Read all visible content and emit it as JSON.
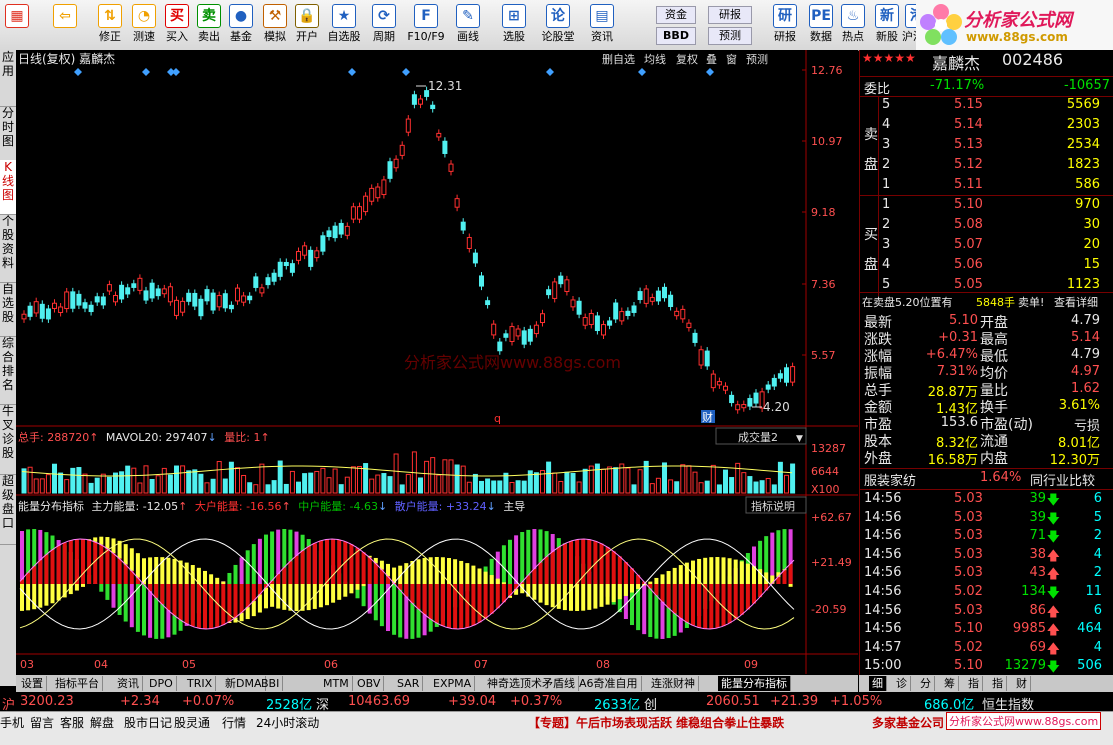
{
  "toolbar": {
    "buttons": [
      {
        "label": "",
        "icon": "windows-icon",
        "color": "#e03020"
      },
      {
        "label": "",
        "icon": "back-arrow-icon",
        "color": "#f0a000"
      },
      {
        "label": "修正",
        "icon": "up-down-icon",
        "color": "#f0a000"
      },
      {
        "label": "测速",
        "icon": "clock-icon",
        "color": "#f0a000"
      },
      {
        "label": "买入",
        "icon": "buy-icon",
        "color": "#e00000"
      },
      {
        "label": "卖出",
        "icon": "sell-icon",
        "color": "#009000"
      },
      {
        "label": "基金",
        "icon": "fund-icon",
        "color": "#2060c0"
      },
      {
        "label": "模拟",
        "icon": "hammer-icon",
        "color": "#c06000"
      },
      {
        "label": "开户",
        "icon": "lock-icon",
        "color": "#806000"
      },
      {
        "label": "自选股",
        "icon": "star-board-icon",
        "color": "#2060c0"
      },
      {
        "label": "周期",
        "icon": "cycle-icon",
        "color": "#2060c0"
      },
      {
        "label": "F10/F9",
        "icon": "f10-icon",
        "color": "#2060c0"
      },
      {
        "label": "画线",
        "icon": "pen-icon",
        "color": "#2060c0"
      },
      {
        "label": "选股",
        "icon": "select-icon",
        "color": "#2060c0"
      },
      {
        "label": "论股堂",
        "icon": "lun-icon",
        "color": "#2060c0"
      },
      {
        "label": "资讯",
        "icon": "news-icon",
        "color": "#2060c0"
      },
      {
        "label": "资金",
        "icon": "money-icon",
        "color": "#2060c0"
      },
      {
        "label": "研报",
        "icon": "report-icon",
        "color": "#2060c0"
      },
      {
        "label": "数据",
        "icon": "pe-icon",
        "color": "#2060c0"
      },
      {
        "label": "热点",
        "icon": "hot-icon",
        "color": "#2060c0"
      },
      {
        "label": "新股",
        "icon": "new-stock-icon",
        "color": "#2060c0"
      },
      {
        "label": "沪港通",
        "icon": "hk-icon",
        "color": "#2060c0"
      }
    ],
    "sub_labels": {
      "money": "资金",
      "bbd": "BBD",
      "report": "研报",
      "forecast": "预测"
    }
  },
  "logo": {
    "title": "分析家公式网",
    "url": "www.88gs.com"
  },
  "left_tabs": [
    "应用",
    "分时图",
    "K线图",
    "个股资料",
    "自选股",
    "综合排名",
    "牛叉诊股",
    "超级盘口"
  ],
  "chart": {
    "header_left": "日线(复权) 嘉麟杰",
    "header_right": [
      "删自选",
      "均线",
      "复权",
      "叠",
      "窗",
      "预测"
    ],
    "watermark": "分析家公式网www.88gs.com",
    "price_ticks": [
      "12.76",
      "10.97",
      "9.18",
      "7.36",
      "5.57",
      "3.77"
    ],
    "high_label": "12.31",
    "low_label": "4.20",
    "volume_header": {
      "v1": "总手: 288720",
      "v2": "MAVOL20: 297407",
      "v3": "量比: 1"
    },
    "volume_select": "成交量2",
    "volume_ticks": [
      "13287",
      "6644",
      "X100"
    ],
    "energy_header": {
      "name": "能量分布指标",
      "main": "主力能量: -12.05",
      "big": "大户能量: -16.56",
      "mid": "中户能量: -4.63",
      "small": "散户能量: +33.24",
      "signal": "主导"
    },
    "energy_button": "指标说明",
    "energy_ticks": [
      "+62.67",
      "+21.49",
      "-20.59"
    ],
    "x_labels": [
      "03",
      "04",
      "05",
      "06",
      "07",
      "08",
      "09"
    ]
  },
  "chart_data": {
    "type": "candlestick",
    "title": "日线(复权) 嘉麟杰",
    "ylim": [
      3.77,
      12.76
    ],
    "high": 12.31,
    "low": 4.2,
    "months": [
      "03",
      "04",
      "05",
      "06",
      "07",
      "08",
      "09"
    ]
  },
  "quote": {
    "stars": "★★★★★",
    "name": "嘉麟杰",
    "code": "002486",
    "weibi_label": "委比",
    "weibi": "-71.17%",
    "weicha": "-10657",
    "sell_label": "卖盘",
    "buy_label": "买盘",
    "sells": [
      {
        "lvl": "5",
        "price": "5.15",
        "vol": "5569"
      },
      {
        "lvl": "4",
        "price": "5.14",
        "vol": "2303"
      },
      {
        "lvl": "3",
        "price": "5.13",
        "vol": "2534"
      },
      {
        "lvl": "2",
        "price": "5.12",
        "vol": "1823"
      },
      {
        "lvl": "1",
        "price": "5.11",
        "vol": "586"
      }
    ],
    "buys": [
      {
        "lvl": "1",
        "price": "5.10",
        "vol": "970"
      },
      {
        "lvl": "2",
        "price": "5.08",
        "vol": "30"
      },
      {
        "lvl": "3",
        "price": "5.07",
        "vol": "20"
      },
      {
        "lvl": "4",
        "price": "5.06",
        "vol": "15"
      },
      {
        "lvl": "5",
        "price": "5.05",
        "vol": "1123"
      }
    ],
    "info_line": {
      "a": "在卖盘5.20位置有",
      "b": "5848手",
      "c": "卖单!",
      "d": "查看详细"
    },
    "stats": [
      {
        "l1": "最新",
        "v1": "5.10",
        "l2": "开盘",
        "v2": "4.79"
      },
      {
        "l1": "涨跌",
        "v1": "+0.31",
        "l2": "最高",
        "v2": "5.14"
      },
      {
        "l1": "涨幅",
        "v1": "+6.47%",
        "l2": "最低",
        "v2": "4.79"
      },
      {
        "l1": "振幅",
        "v1": "7.31%",
        "l2": "均价",
        "v2": "4.97"
      },
      {
        "l1": "总手",
        "v1": "28.87万",
        "l2": "量比",
        "v2": "1.62"
      },
      {
        "l1": "金额",
        "v1": "1.43亿",
        "l2": "换手",
        "v2": "3.61%"
      },
      {
        "l1": "市盈",
        "v1": "153.6",
        "l2": "市盈(动)",
        "v2": "亏损"
      },
      {
        "l1": "股本",
        "v1": "8.32亿",
        "l2": "流通",
        "v2": "8.01亿"
      },
      {
        "l1": "外盘",
        "v1": "16.58万",
        "l2": "内盘",
        "v2": "12.30万"
      }
    ],
    "industry": {
      "name": "服装家纺",
      "pct": "1.64%",
      "compare": "同行业比较"
    },
    "ticks": [
      {
        "t": "14:56",
        "p": "5.03",
        "v": "39",
        "d": "down",
        "n": "6"
      },
      {
        "t": "14:56",
        "p": "5.03",
        "v": "39",
        "d": "down",
        "n": "5"
      },
      {
        "t": "14:56",
        "p": "5.03",
        "v": "71",
        "d": "down",
        "n": "2"
      },
      {
        "t": "14:56",
        "p": "5.03",
        "v": "38",
        "d": "up",
        "n": "4"
      },
      {
        "t": "14:56",
        "p": "5.03",
        "v": "43",
        "d": "up",
        "n": "2"
      },
      {
        "t": "14:56",
        "p": "5.02",
        "v": "134",
        "d": "down",
        "n": "11"
      },
      {
        "t": "14:56",
        "p": "5.03",
        "v": "86",
        "d": "up",
        "n": "6"
      },
      {
        "t": "14:56",
        "p": "5.10",
        "v": "9985",
        "d": "up",
        "n": "464"
      },
      {
        "t": "14:57",
        "p": "5.02",
        "v": "69",
        "d": "up",
        "n": "4"
      },
      {
        "t": "15:00",
        "p": "5.10",
        "v": "13279",
        "d": "down",
        "n": "506"
      }
    ]
  },
  "bottom_tabs": [
    "设置",
    "指标平台",
    "资讯",
    "DPO",
    "TRIX",
    "新DMA",
    "BBI",
    "MTM",
    "OBV",
    "SAR",
    "EXPMA",
    "神奇选顶术矛盾线",
    "A6奇准自用",
    "连涨财神",
    "能量分布指标"
  ],
  "right_tabs": [
    "细",
    "诊",
    "分",
    "筹",
    "指",
    "指",
    "财"
  ],
  "status_line": {
    "sh_label": "沪",
    "sh": "3200.23",
    "sh_chg": "+2.34",
    "sh_pct": "+0.07%",
    "sh_amt": "2528亿",
    "sz_label": "深",
    "sz": "10463.69",
    "sz_chg": "+39.04",
    "sz_pct": "+0.37%",
    "sz_amt": "2633亿",
    "cy_label": "创",
    "cy": "2060.51",
    "cy_chg": "+21.39",
    "cy_pct": "+1.05%",
    "cy_amt": "686.0亿",
    "hs_label": "恒生指数"
  },
  "footer": {
    "items": [
      "手机",
      "留言",
      "客服",
      "解盘",
      "股市日记",
      "股灵通",
      "行情",
      "24小时滚动"
    ],
    "news": "【专题】午后市场表现活跃 维稳组合拳止住暴跌",
    "news2": "多家基金公司",
    "site": "分析家公式网www.88gs.com"
  }
}
